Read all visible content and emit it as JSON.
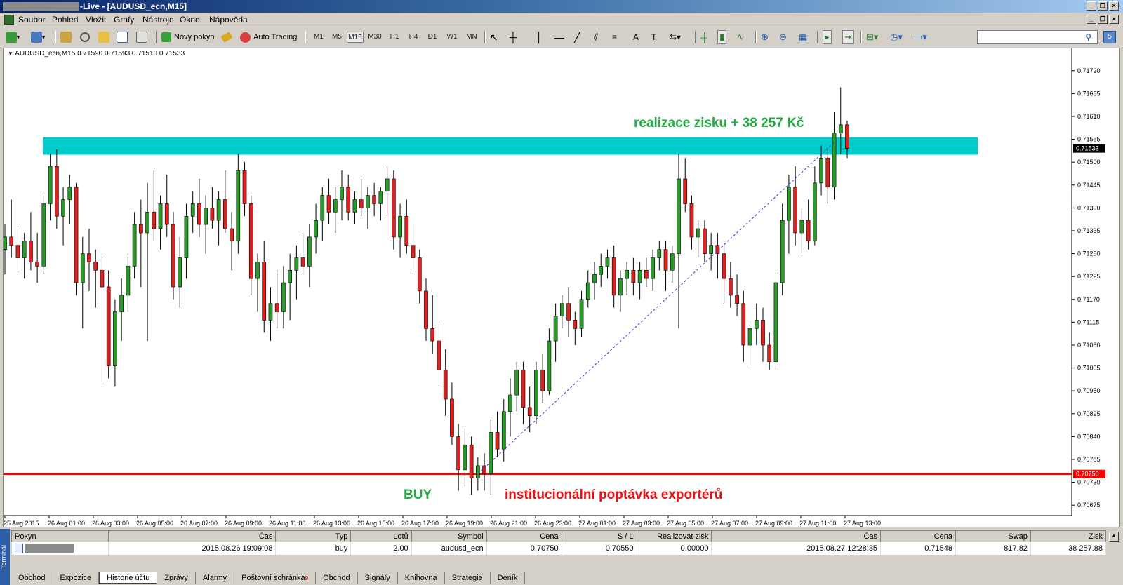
{
  "window": {
    "title": "-Live - [AUDUSD_ecn,M15]"
  },
  "menu": {
    "items": [
      "Soubor",
      "Pohled",
      "Vložit",
      "Grafy",
      "Nástroje",
      "Okno",
      "Nápověda"
    ]
  },
  "toolbar": {
    "new_order": "Nový pokyn",
    "auto_trading": "Auto Trading",
    "timeframes": [
      "M1",
      "M5",
      "M15",
      "M30",
      "H1",
      "H4",
      "D1",
      "W1",
      "MN"
    ],
    "active_timeframe": "M15"
  },
  "chart": {
    "header": "AUDUSD_ecn,M15  0.71590 0.71593 0.71510 0.71533",
    "profit_label": "realizace zisku + 38 257 Kč",
    "buy_label": "BUY",
    "demand_label": "institucionální poptávka exportérů",
    "current_price": "0.71533",
    "support_price": "0.70750",
    "colors": {
      "bull": "#2a9a2a",
      "bear": "#dd2020",
      "zone": "#00cccc",
      "support": "#ff0000",
      "profit_text": "#22aa44",
      "buy_text": "#22aa44",
      "demand_text": "#ee1111"
    }
  },
  "chart_data": {
    "type": "candlestick",
    "symbol": "AUDUSD_ecn",
    "timeframe": "M15",
    "ylim": [
      0.7065,
      0.7175
    ],
    "y_ticks": [
      "0.71720",
      "0.71665",
      "0.71610",
      "0.71555",
      "0.71500",
      "0.71445",
      "0.71390",
      "0.71335",
      "0.71280",
      "0.71225",
      "0.71170",
      "0.71115",
      "0.71060",
      "0.71005",
      "0.70950",
      "0.70895",
      "0.70840",
      "0.70785",
      "0.70730",
      "0.70675"
    ],
    "x_ticks": [
      "25 Aug 2015",
      "26 Aug 01:00",
      "26 Aug 03:00",
      "26 Aug 05:00",
      "26 Aug 07:00",
      "26 Aug 09:00",
      "26 Aug 11:00",
      "26 Aug 13:00",
      "26 Aug 15:00",
      "26 Aug 17:00",
      "26 Aug 19:00",
      "26 Aug 21:00",
      "26 Aug 23:00",
      "27 Aug 01:00",
      "27 Aug 03:00",
      "27 Aug 05:00",
      "27 Aug 07:00",
      "27 Aug 09:00",
      "27 Aug 11:00",
      "27 Aug 13:00"
    ],
    "resistance_zone": [
      0.71518,
      0.7156
    ],
    "support_level": 0.7075,
    "trade_line": {
      "from": 0.7075,
      "to": 0.71548
    },
    "candles": [
      [
        0.7129,
        0.7135,
        0.7123,
        0.7132
      ],
      [
        0.7132,
        0.7141,
        0.7127,
        0.713
      ],
      [
        0.713,
        0.7134,
        0.7124,
        0.7127
      ],
      [
        0.7127,
        0.7133,
        0.7122,
        0.7131
      ],
      [
        0.7131,
        0.7138,
        0.7124,
        0.7126
      ],
      [
        0.7126,
        0.7133,
        0.7121,
        0.7125
      ],
      [
        0.7125,
        0.7142,
        0.7123,
        0.714
      ],
      [
        0.714,
        0.7152,
        0.7136,
        0.7149
      ],
      [
        0.7149,
        0.7153,
        0.7134,
        0.7137
      ],
      [
        0.7137,
        0.7144,
        0.713,
        0.7141
      ],
      [
        0.7141,
        0.7147,
        0.7135,
        0.7144
      ],
      [
        0.7144,
        0.7145,
        0.7118,
        0.7121
      ],
      [
        0.7121,
        0.7132,
        0.711,
        0.7128
      ],
      [
        0.7128,
        0.7134,
        0.7119,
        0.7126
      ],
      [
        0.7126,
        0.7129,
        0.7115,
        0.7124
      ],
      [
        0.7124,
        0.7128,
        0.7097,
        0.712
      ],
      [
        0.712,
        0.7124,
        0.7098,
        0.7101
      ],
      [
        0.7101,
        0.7117,
        0.7096,
        0.7114
      ],
      [
        0.7114,
        0.7122,
        0.7107,
        0.7118
      ],
      [
        0.7118,
        0.7128,
        0.7114,
        0.7125
      ],
      [
        0.7125,
        0.7138,
        0.7122,
        0.7135
      ],
      [
        0.7135,
        0.7141,
        0.712,
        0.7133
      ],
      [
        0.7133,
        0.7145,
        0.7107,
        0.7138
      ],
      [
        0.7138,
        0.7148,
        0.7131,
        0.7134
      ],
      [
        0.7134,
        0.7142,
        0.7129,
        0.714
      ],
      [
        0.714,
        0.7147,
        0.7132,
        0.7135
      ],
      [
        0.7135,
        0.7138,
        0.7117,
        0.712
      ],
      [
        0.712,
        0.7132,
        0.7115,
        0.7127
      ],
      [
        0.7127,
        0.714,
        0.7122,
        0.7137
      ],
      [
        0.7137,
        0.7143,
        0.7133,
        0.714
      ],
      [
        0.714,
        0.7146,
        0.7132,
        0.7135
      ],
      [
        0.7135,
        0.7142,
        0.7128,
        0.7139
      ],
      [
        0.7139,
        0.7144,
        0.7134,
        0.7136
      ],
      [
        0.7136,
        0.7143,
        0.713,
        0.7141
      ],
      [
        0.7141,
        0.7148,
        0.7133,
        0.7134
      ],
      [
        0.7134,
        0.7138,
        0.7124,
        0.7131
      ],
      [
        0.7131,
        0.7152,
        0.7128,
        0.7148
      ],
      [
        0.7148,
        0.715,
        0.7137,
        0.714
      ],
      [
        0.714,
        0.7142,
        0.7118,
        0.7122
      ],
      [
        0.7122,
        0.7128,
        0.7114,
        0.7126
      ],
      [
        0.7126,
        0.7131,
        0.7109,
        0.7112
      ],
      [
        0.7112,
        0.712,
        0.7107,
        0.7116
      ],
      [
        0.7116,
        0.7124,
        0.711,
        0.7114
      ],
      [
        0.7114,
        0.7125,
        0.711,
        0.7121
      ],
      [
        0.7121,
        0.7128,
        0.7112,
        0.7124
      ],
      [
        0.7124,
        0.713,
        0.7117,
        0.7127
      ],
      [
        0.7127,
        0.7133,
        0.7123,
        0.7125
      ],
      [
        0.7125,
        0.7135,
        0.712,
        0.7132
      ],
      [
        0.7132,
        0.714,
        0.7128,
        0.7136
      ],
      [
        0.7136,
        0.7144,
        0.7131,
        0.7142
      ],
      [
        0.7142,
        0.7146,
        0.7135,
        0.7138
      ],
      [
        0.7138,
        0.7144,
        0.7133,
        0.7141
      ],
      [
        0.7141,
        0.7148,
        0.7136,
        0.7144
      ],
      [
        0.7144,
        0.7147,
        0.7136,
        0.7138
      ],
      [
        0.7138,
        0.7143,
        0.7135,
        0.7141
      ],
      [
        0.7141,
        0.7146,
        0.7137,
        0.7139
      ],
      [
        0.7139,
        0.7144,
        0.7134,
        0.7142
      ],
      [
        0.7142,
        0.7145,
        0.7137,
        0.714
      ],
      [
        0.714,
        0.7144,
        0.7136,
        0.7143
      ],
      [
        0.7143,
        0.7149,
        0.7137,
        0.7146
      ],
      [
        0.7146,
        0.7148,
        0.7129,
        0.7132
      ],
      [
        0.7132,
        0.714,
        0.7127,
        0.7137
      ],
      [
        0.7137,
        0.7141,
        0.7128,
        0.713
      ],
      [
        0.713,
        0.7135,
        0.7123,
        0.7127
      ],
      [
        0.7127,
        0.7129,
        0.7116,
        0.7119
      ],
      [
        0.7119,
        0.7122,
        0.7107,
        0.711
      ],
      [
        0.711,
        0.7118,
        0.7104,
        0.7107
      ],
      [
        0.7107,
        0.7111,
        0.7096,
        0.71
      ],
      [
        0.71,
        0.7105,
        0.7089,
        0.7093
      ],
      [
        0.7093,
        0.7097,
        0.7082,
        0.7084
      ],
      [
        0.7084,
        0.7087,
        0.7071,
        0.7076
      ],
      [
        0.7076,
        0.7086,
        0.7072,
        0.7082
      ],
      [
        0.7082,
        0.7084,
        0.707,
        0.7074
      ],
      [
        0.7074,
        0.7079,
        0.7071,
        0.7077
      ],
      [
        0.7077,
        0.708,
        0.7071,
        0.7075
      ],
      [
        0.7075,
        0.7088,
        0.707,
        0.7085
      ],
      [
        0.7085,
        0.709,
        0.7079,
        0.7081
      ],
      [
        0.7081,
        0.7093,
        0.7078,
        0.709
      ],
      [
        0.709,
        0.7098,
        0.7084,
        0.7094
      ],
      [
        0.7094,
        0.7102,
        0.709,
        0.71
      ],
      [
        0.71,
        0.7102,
        0.7087,
        0.7091
      ],
      [
        0.7091,
        0.7096,
        0.7085,
        0.7089
      ],
      [
        0.7089,
        0.7102,
        0.7087,
        0.71
      ],
      [
        0.71,
        0.7104,
        0.7092,
        0.7095
      ],
      [
        0.7095,
        0.711,
        0.7094,
        0.7107
      ],
      [
        0.7107,
        0.7116,
        0.7102,
        0.7113
      ],
      [
        0.7113,
        0.7118,
        0.711,
        0.7116
      ],
      [
        0.7116,
        0.712,
        0.7108,
        0.7112
      ],
      [
        0.7112,
        0.7114,
        0.7106,
        0.711
      ],
      [
        0.711,
        0.7119,
        0.7108,
        0.7117
      ],
      [
        0.7117,
        0.7124,
        0.7115,
        0.7121
      ],
      [
        0.7121,
        0.7126,
        0.7117,
        0.7123
      ],
      [
        0.7123,
        0.7128,
        0.712,
        0.7125
      ],
      [
        0.7125,
        0.7129,
        0.7122,
        0.7127
      ],
      [
        0.7127,
        0.713,
        0.7115,
        0.7118
      ],
      [
        0.7118,
        0.7124,
        0.7114,
        0.7122
      ],
      [
        0.7122,
        0.7126,
        0.7118,
        0.7124
      ],
      [
        0.7124,
        0.7127,
        0.7118,
        0.7121
      ],
      [
        0.7121,
        0.7126,
        0.7117,
        0.7124
      ],
      [
        0.7124,
        0.7127,
        0.712,
        0.7122
      ],
      [
        0.7122,
        0.7129,
        0.7119,
        0.7127
      ],
      [
        0.7127,
        0.7131,
        0.7124,
        0.7129
      ],
      [
        0.7129,
        0.7131,
        0.7119,
        0.7124
      ],
      [
        0.7124,
        0.713,
        0.7121,
        0.7128
      ],
      [
        0.7128,
        0.7152,
        0.711,
        0.7146
      ],
      [
        0.7146,
        0.7151,
        0.7138,
        0.714
      ],
      [
        0.714,
        0.7142,
        0.7129,
        0.7132
      ],
      [
        0.7132,
        0.7136,
        0.7127,
        0.7134
      ],
      [
        0.7134,
        0.7136,
        0.7126,
        0.7128
      ],
      [
        0.7128,
        0.7133,
        0.7124,
        0.713
      ],
      [
        0.713,
        0.7133,
        0.7122,
        0.7128
      ],
      [
        0.7128,
        0.7131,
        0.7116,
        0.7122
      ],
      [
        0.7122,
        0.7126,
        0.7115,
        0.7118
      ],
      [
        0.7118,
        0.7123,
        0.7113,
        0.7116
      ],
      [
        0.7116,
        0.7119,
        0.7102,
        0.7106
      ],
      [
        0.7106,
        0.7112,
        0.7101,
        0.711
      ],
      [
        0.711,
        0.7116,
        0.7106,
        0.7112
      ],
      [
        0.7112,
        0.7115,
        0.7102,
        0.7106
      ],
      [
        0.7106,
        0.7109,
        0.71,
        0.7102
      ],
      [
        0.7102,
        0.7124,
        0.71,
        0.7121
      ],
      [
        0.7121,
        0.714,
        0.7118,
        0.7136
      ],
      [
        0.7136,
        0.7147,
        0.7128,
        0.7144
      ],
      [
        0.7144,
        0.7149,
        0.713,
        0.7133
      ],
      [
        0.7133,
        0.7139,
        0.7128,
        0.7136
      ],
      [
        0.7136,
        0.7141,
        0.7129,
        0.7131
      ],
      [
        0.7131,
        0.7149,
        0.713,
        0.7145
      ],
      [
        0.7145,
        0.7154,
        0.7142,
        0.7151
      ],
      [
        0.7151,
        0.7153,
        0.714,
        0.7144
      ],
      [
        0.7144,
        0.7162,
        0.7141,
        0.7157
      ],
      [
        0.7157,
        0.7168,
        0.7152,
        0.7159
      ],
      [
        0.7159,
        0.716,
        0.7151,
        0.71533
      ]
    ]
  },
  "terminal": {
    "label": "Terminál",
    "columns": [
      "Pokyn",
      "Čas",
      "Typ",
      "Lotů",
      "Symbol",
      "Cena",
      "S / L",
      "Realizovat zisk",
      "Čas",
      "Cena",
      "Swap",
      "Zisk"
    ],
    "rows": [
      {
        "time": "2015.08.26 19:09:08",
        "type": "buy",
        "lots": "2.00",
        "symbol": "audusd_ecn",
        "price": "0.70750",
        "sl": "0.70550",
        "tp": "0.00000",
        "close_time": "2015.08.27 12:28:35",
        "close_price": "0.71548",
        "swap": "817.82",
        "profit": "38 257.88"
      }
    ],
    "tabs": [
      "Obchod",
      "Expozice",
      "Historie účtu",
      "Zprávy",
      "Alarmy",
      "Poštovní schránka",
      "Obchod",
      "Signály",
      "Knihovna",
      "Strategie",
      "Deník"
    ],
    "active_tab": "Historie účtu",
    "mailbox_badge": "9"
  }
}
